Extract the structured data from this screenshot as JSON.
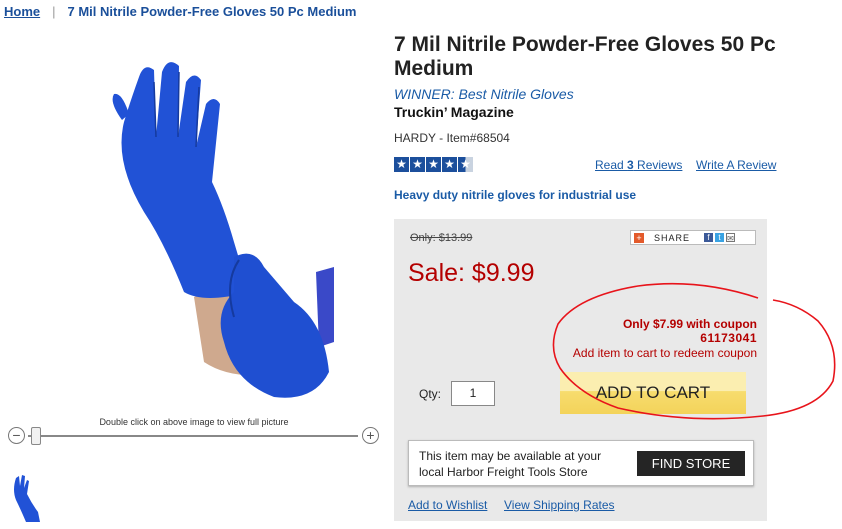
{
  "breadcrumb": {
    "home": "Home",
    "separator": "|",
    "current": "7 Mil Nitrile Powder-Free Gloves 50 Pc Medium"
  },
  "image": {
    "hint": "Double click on above image to view full picture",
    "zoom_minus": "−",
    "zoom_plus": "+"
  },
  "product": {
    "title": "7 Mil Nitrile Powder-Free Gloves 50 Pc Medium",
    "award": "WINNER: Best Nitrile Gloves",
    "magazine": "Truckin’ Magazine",
    "sku": "HARDY - Item#68504",
    "rating": 4.5,
    "rating_max": 5,
    "reviews_prefix": "Read ",
    "reviews_count": "3",
    "reviews_suffix": " Reviews",
    "write_review": "Write A Review",
    "tagline": "Heavy duty nitrile gloves for industrial use"
  },
  "pricing": {
    "old_price": "Only: $13.99",
    "share_label": "SHARE",
    "sale_price": "Sale: $9.99",
    "coupon_line": "Only $7.99 with coupon",
    "coupon_code": "61173041",
    "coupon_note": "Add item to cart to redeem coupon",
    "qty_label": "Qty:",
    "qty_value": "1",
    "add_to_cart": "ADD TO CART"
  },
  "store": {
    "message": "This item may be available at your local Harbor Freight Tools Store",
    "find_store": "FIND STORE"
  },
  "links": {
    "wishlist": "Add to Wishlist",
    "shipping": "View Shipping Rates"
  },
  "colors": {
    "link_blue": "#1a5ba6",
    "sale_red": "#b40000",
    "glove_blue": "#1f4fd1",
    "annotation_red": "#e8141b"
  },
  "icons": {
    "share": "share-plus-icon",
    "facebook": "facebook-icon",
    "twitter": "twitter-icon",
    "email": "email-icon"
  }
}
